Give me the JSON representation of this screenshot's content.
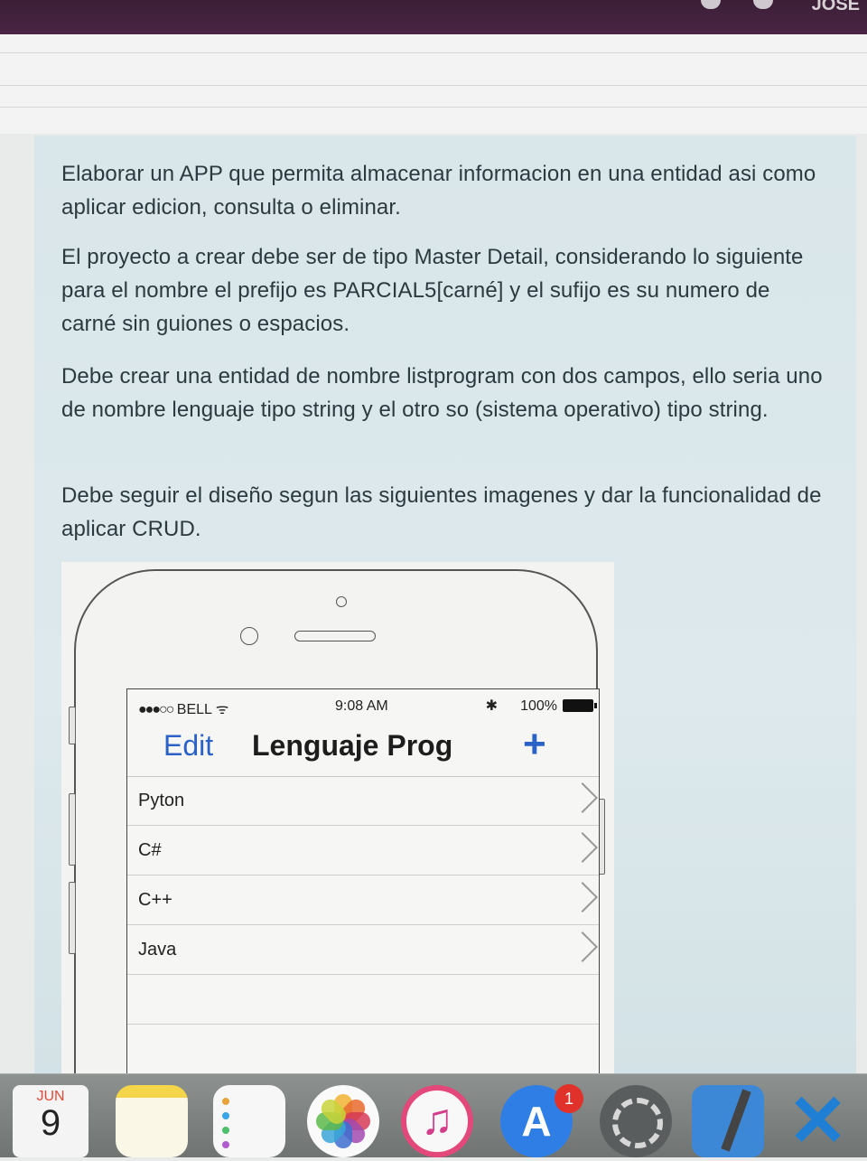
{
  "topbar": {
    "user_label": "JOSE"
  },
  "content": {
    "paragraphs": [
      "Elaborar un APP que permita almacenar informacion en una entidad asi como aplicar edicion, consulta o eliminar.",
      "El proyecto a crear debe ser de tipo Master Detail, considerando lo siguiente para el nombre el prefijo es PARCIAL5[carné] y el sufijo es su numero de carné sin guiones o espacios.",
      "Debe crear una entidad de nombre listprogram con dos campos, ello seria uno de nombre lenguaje tipo string y el otro so (sistema operativo) tipo string.",
      "Debe seguir el diseño segun las siguientes imagenes y dar la funcionalidad de aplicar CRUD."
    ]
  },
  "mockup": {
    "status": {
      "signal": "●●●○○",
      "carrier": "BELL",
      "wifi": "ᯤ",
      "time": "9:08 AM",
      "bluetooth": "✱",
      "battery": "100%"
    },
    "nav": {
      "edit": "Edit",
      "title": "Lenguaje Prog",
      "add": "+"
    },
    "rows": [
      {
        "label": "Pyton"
      },
      {
        "label": "C#"
      },
      {
        "label": "C++"
      },
      {
        "label": "Java"
      }
    ]
  },
  "dock": {
    "calendar_month": "JUN",
    "calendar_day": "9",
    "itunes_glyph": "♫",
    "appstore_glyph": "A",
    "appstore_badge": "1",
    "vscode_glyph": "✕",
    "colors": {
      "dock_bg": "#7d8280",
      "ios_blue": "#2a62c8",
      "badge": "#e0322a"
    }
  }
}
